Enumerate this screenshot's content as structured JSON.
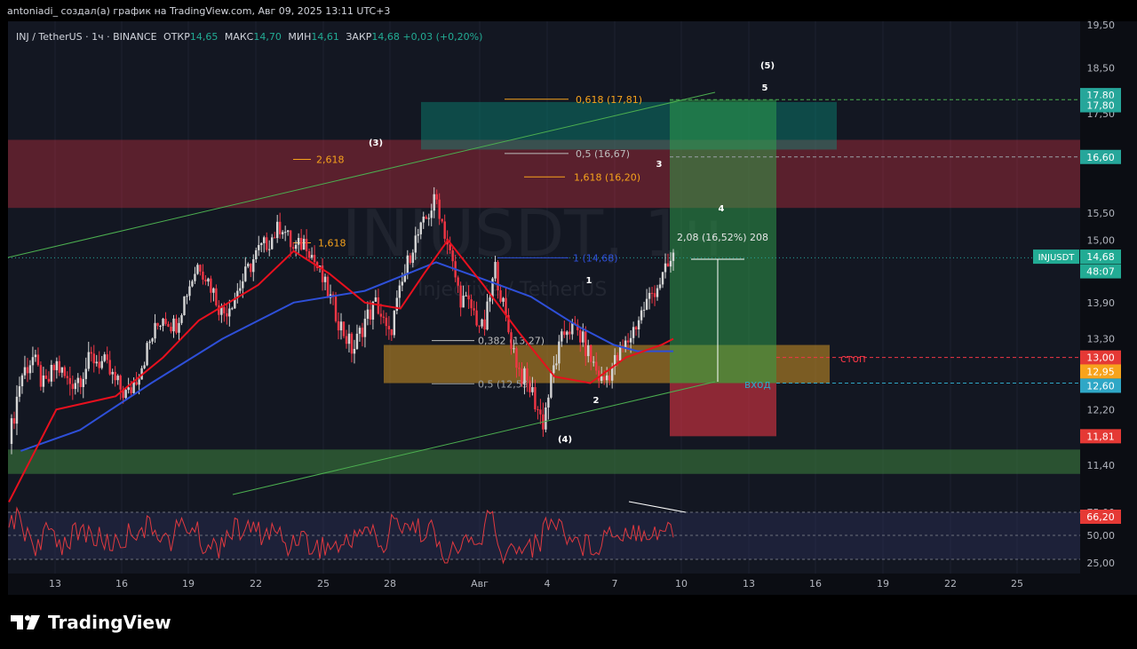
{
  "header": {
    "caption": "antoniadi_ создал(а) график на TradingView.com, Авг 09, 2025 13:11 UTC+3"
  },
  "legend": {
    "symbol": "INJ / TetherUS · 1ч · BINANCE",
    "open_label": "ОТКР",
    "open": "14,65",
    "high_label": "МАКС",
    "high": "14,70",
    "low_label": "МИН",
    "low": "14,61",
    "close_label": "ЗАКР",
    "close": "14,68",
    "change": "+0,03 (+0,20%)"
  },
  "watermark": {
    "ticker": "INJUSDT, 1ч",
    "name": "Injective / TetherUS"
  },
  "brand": {
    "name": "TradingView"
  },
  "colors": {
    "background": "#131722",
    "candle_up": "#d5d5d5",
    "candle_down": "#f23645",
    "ema_fast": "#e8101e",
    "ema_slow": "#2e4fd8",
    "rsi": "#e0393f",
    "fib": "#f7a31c",
    "channel": "#4caf50",
    "target_zone": "#089981",
    "stop_zone": "#f23645"
  },
  "chart_data": {
    "type": "candlestick",
    "symbol": "INJUSDT",
    "timeframe": "1ч",
    "ylim": [
      10.9,
      19.6
    ],
    "y_ticks": [
      "19,50",
      "18,50",
      "17,50",
      "15,50",
      "15,00",
      "13,90",
      "13,30",
      "12,20",
      "11,40"
    ],
    "x_ticks": [
      "13",
      "16",
      "19",
      "22",
      "25",
      "28",
      "Авг",
      "4",
      "7",
      "10",
      "13",
      "16",
      "19",
      "22",
      "25"
    ],
    "price_path": [
      [
        0,
        11.7
      ],
      [
        1,
        12.7
      ],
      [
        2,
        13.0
      ],
      [
        3,
        12.5
      ],
      [
        4,
        12.9
      ],
      [
        5,
        12.6
      ],
      [
        6,
        12.7
      ],
      [
        7,
        13.0
      ],
      [
        8,
        12.9
      ],
      [
        9,
        12.6
      ],
      [
        10,
        12.4
      ],
      [
        11,
        12.8
      ],
      [
        12,
        13.3
      ],
      [
        13,
        13.7
      ],
      [
        14,
        13.5
      ],
      [
        15,
        14.1
      ],
      [
        16,
        14.6
      ],
      [
        17,
        14.2
      ],
      [
        18,
        13.7
      ],
      [
        19,
        14.0
      ],
      [
        20,
        14.4
      ],
      [
        21,
        14.8
      ],
      [
        22,
        15.0
      ],
      [
        23,
        15.3
      ],
      [
        24,
        14.8
      ],
      [
        25,
        15.0
      ],
      [
        26,
        14.5
      ],
      [
        27,
        14.0
      ],
      [
        28,
        13.5
      ],
      [
        29,
        13.1
      ],
      [
        30,
        13.6
      ],
      [
        31,
        13.9
      ],
      [
        32,
        13.3
      ],
      [
        33,
        14.1
      ],
      [
        34,
        14.9
      ],
      [
        35,
        15.3
      ],
      [
        36,
        15.8
      ],
      [
        37,
        14.9
      ],
      [
        38,
        14.0
      ],
      [
        39,
        13.8
      ],
      [
        40,
        13.4
      ],
      [
        41,
        14.5
      ],
      [
        42,
        13.5
      ],
      [
        43,
        12.8
      ],
      [
        44,
        12.5
      ],
      [
        45,
        12.0
      ],
      [
        46,
        12.9
      ],
      [
        47,
        13.5
      ],
      [
        48,
        13.4
      ],
      [
        49,
        13.0
      ],
      [
        50,
        12.6
      ],
      [
        51,
        12.9
      ],
      [
        52,
        13.2
      ],
      [
        53,
        13.6
      ],
      [
        54,
        14.0
      ],
      [
        55,
        14.3
      ],
      [
        56,
        14.68
      ]
    ],
    "ema_fast": [
      [
        0,
        10.9
      ],
      [
        4,
        12.2
      ],
      [
        9,
        12.4
      ],
      [
        13,
        13.0
      ],
      [
        16,
        13.6
      ],
      [
        21,
        14.2
      ],
      [
        24,
        14.8
      ],
      [
        27,
        14.4
      ],
      [
        30,
        13.9
      ],
      [
        33,
        13.8
      ],
      [
        35,
        14.4
      ],
      [
        37,
        15.0
      ],
      [
        40,
        14.2
      ],
      [
        43,
        13.4
      ],
      [
        46,
        12.7
      ],
      [
        49,
        12.6
      ],
      [
        52,
        13.0
      ],
      [
        55,
        13.2
      ],
      [
        56,
        13.3
      ]
    ],
    "ema_slow": [
      [
        1,
        11.6
      ],
      [
        6,
        11.9
      ],
      [
        12,
        12.6
      ],
      [
        18,
        13.3
      ],
      [
        24,
        13.9
      ],
      [
        30,
        14.1
      ],
      [
        36,
        14.6
      ],
      [
        40,
        14.3
      ],
      [
        44,
        14.0
      ],
      [
        48,
        13.5
      ],
      [
        51,
        13.2
      ],
      [
        53,
        13.1
      ],
      [
        56,
        13.1
      ]
    ],
    "rsi": {
      "value": "66,20",
      "levels": [
        "75,00",
        "50,00",
        "25,00"
      ]
    },
    "fibonacci": [
      {
        "label": "0,618 (17,81)",
        "price": 17.81
      },
      {
        "label": "0,5 (16,67)",
        "price": 16.67
      },
      {
        "label": "1,618 (16,20)",
        "price": 16.2
      },
      {
        "label": "2,618",
        "price": 16.55
      },
      {
        "label": "1,618",
        "price": 14.95
      },
      {
        "label": "1 (14,68)",
        "price": 14.68
      },
      {
        "label": "0,382 (13,27)",
        "price": 13.27
      },
      {
        "label": "0,5 (12,59)",
        "price": 12.59
      }
    ],
    "waves": [
      "(3)",
      "(4)",
      "(5)",
      "1",
      "2",
      "3",
      "4",
      "5"
    ],
    "annotations": {
      "measure": "2,08 (16,52%) 208",
      "stop": "стоп",
      "entry": "вход"
    },
    "price_labels": [
      {
        "text": "17,80",
        "price": 17.9
      },
      {
        "text": "17,80",
        "price": 17.68
      },
      {
        "text": "16,60",
        "price": 16.6
      },
      {
        "text": "14,68",
        "price": 14.7
      },
      {
        "text": "48:07",
        "price": 14.44
      },
      {
        "text": "13,00",
        "price": 13.0
      },
      {
        "text": "12,95",
        "price": 12.78
      },
      {
        "text": "12,60",
        "price": 12.56
      },
      {
        "text": "11,81",
        "price": 11.81
      }
    ],
    "symbol_badge": "INJUSDT"
  }
}
